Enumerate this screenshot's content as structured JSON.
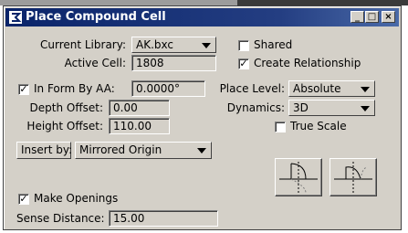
{
  "window": {
    "title": "Place Compound Cell",
    "minimize": "_",
    "maximize": "□",
    "close": "×"
  },
  "current_library": {
    "label": "Current Library:",
    "value": "AK.bxc"
  },
  "active_cell": {
    "label": "Active Cell:",
    "value": "1808"
  },
  "shared": {
    "label": "Shared",
    "checked": false
  },
  "create_relationship": {
    "label": "Create Relationship",
    "checked": true
  },
  "in_form_by_aa": {
    "label": "In Form  By AA:",
    "value": "0.0000°",
    "checked": true
  },
  "place_level": {
    "label": "Place Level:",
    "value": "Absolute"
  },
  "depth_offset": {
    "label": "Depth Offset:",
    "value": "0.00"
  },
  "dynamics": {
    "label": "Dynamics:",
    "value": "3D"
  },
  "height_offset": {
    "label": "Height Offset:",
    "value": "110.00"
  },
  "true_scale": {
    "label": "True Scale",
    "checked": false
  },
  "insert_by": {
    "label": "Insert by:",
    "value": "Mirrored Origin"
  },
  "make_openings": {
    "label": "Make Openings",
    "checked": true
  },
  "sense_distance": {
    "label": "Sense Distance:",
    "value": "15.00"
  },
  "icons": [
    "mirror-vertical-icon",
    "mirror-horizontal-icon"
  ]
}
